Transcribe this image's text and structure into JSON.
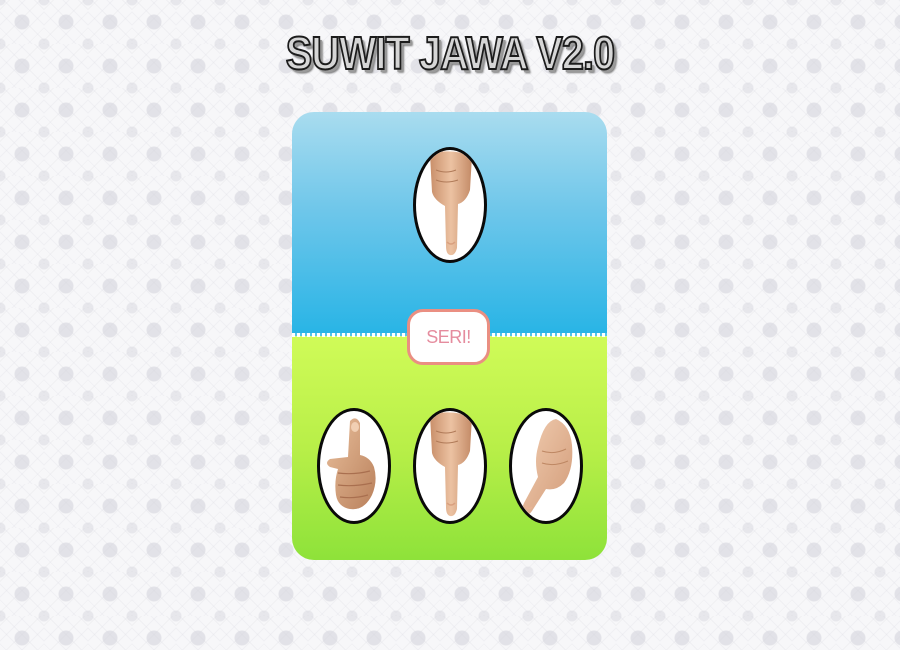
{
  "title": "SUWIT JAWA V2.0",
  "result_text": "SERI!",
  "computer_choice": "manusia-hand-icon",
  "player_choices": [
    "gajah-thumb-icon",
    "manusia-index-finger-icon",
    "semut-pinky-finger-icon"
  ],
  "colors": {
    "computer_area_top": "#a9dcef",
    "computer_area_bottom": "#27b4e6",
    "player_area_top": "#d0fb58",
    "player_area_bottom": "#8ee23a",
    "result_border": "#ea8f82",
    "result_text": "#e58c9e",
    "skin": "#e2b28e"
  }
}
